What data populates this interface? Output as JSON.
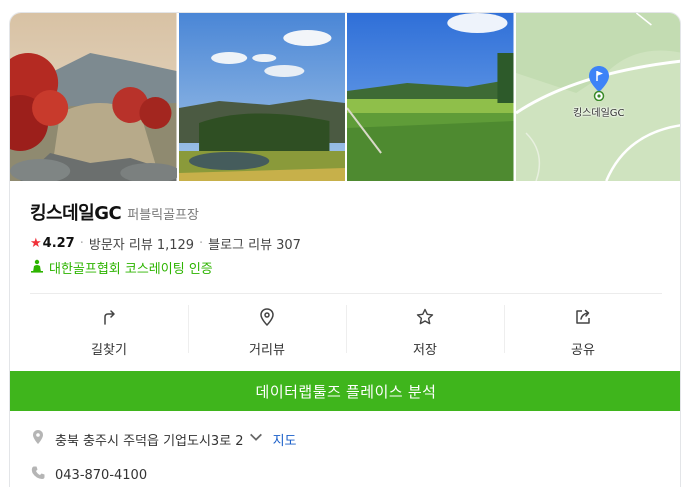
{
  "place": {
    "name": "킹스데일GC",
    "category": "퍼블릭골프장"
  },
  "rating": {
    "score": "4.27",
    "visitor_reviews_label": "방문자 리뷰",
    "visitor_reviews_count": "1,129",
    "blog_reviews_label": "블로그 리뷰",
    "blog_reviews_count": "307"
  },
  "certification": {
    "text": "대한골프협회 코스레이팅 인증"
  },
  "photos": {
    "map_label": "킹스데일GC",
    "items": [
      "red-foliage-photo",
      "lake-hill-photo",
      "fairway-photo",
      "location-map"
    ]
  },
  "actions": [
    {
      "label": "길찾기",
      "icon": "directions-icon"
    },
    {
      "label": "거리뷰",
      "icon": "location-pin-icon"
    },
    {
      "label": "저장",
      "icon": "star-outline-icon"
    },
    {
      "label": "공유",
      "icon": "share-icon"
    }
  ],
  "analysis_button": {
    "label": "데이터랩툴즈 플레이스 분석"
  },
  "address": {
    "text": "충북 충주시 주덕읍 기업도시3로 2",
    "map_link": "지도"
  },
  "phone": {
    "number": "043-870-4100"
  },
  "colors": {
    "accent_green": "#3fb51c",
    "cert_green": "#2db400",
    "rating_red": "#f0323a",
    "link_blue": "#1a5fc9"
  }
}
